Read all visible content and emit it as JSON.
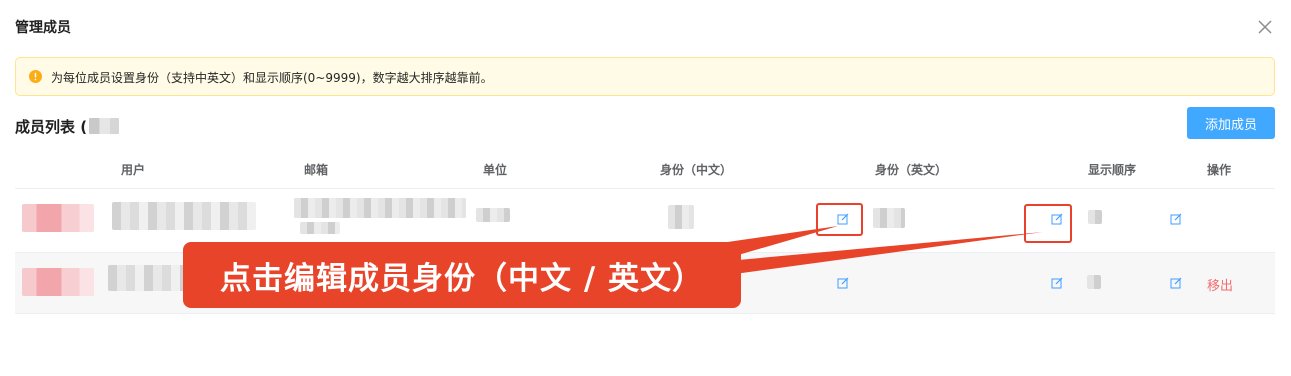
{
  "dialog": {
    "title": "管理成员"
  },
  "alert": {
    "text": "为每位成员设置身份（支持中英文）和显示顺序(0~9999)，数字越大排序越靠前。"
  },
  "section": {
    "title": "成员列表 ("
  },
  "add_button": {
    "label": "添加成员"
  },
  "table": {
    "headers": {
      "user": "用户",
      "email": "邮箱",
      "unit": "单位",
      "role_cn": "身份（中文）",
      "role_en": "身份（英文）",
      "order": "显示顺序",
      "actions": "操作"
    },
    "rows": [
      {
        "remove_label": ""
      },
      {
        "remove_label": "移出"
      }
    ]
  },
  "annotation": {
    "text": "点击编辑成员身份（中文 / 英文）"
  },
  "colors": {
    "accent": "#40a9ff",
    "danger": "#f56c6c",
    "annotation": "#e8442a",
    "alert_bg": "#fffbe6"
  },
  "icons": {
    "close": "close-icon",
    "warning": "exclamation-circle-icon",
    "edit": "edit-icon"
  }
}
